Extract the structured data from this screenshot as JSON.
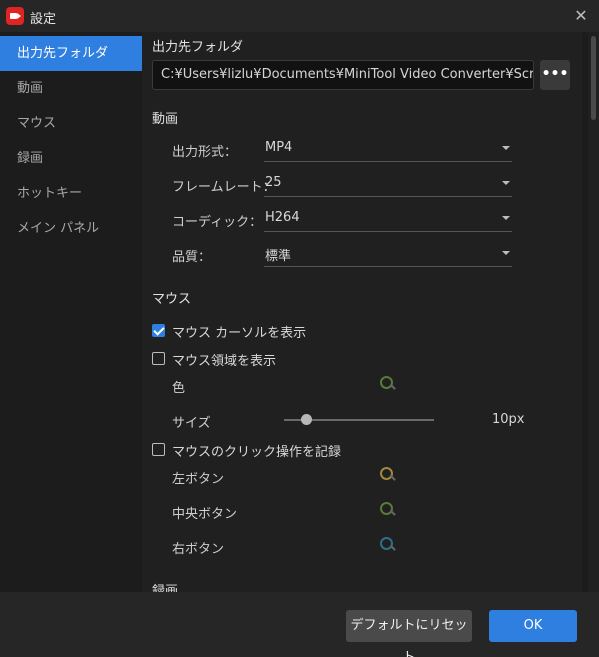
{
  "window": {
    "title": "設定",
    "close_glyph": "✕"
  },
  "sidebar": {
    "items": [
      {
        "label": "出力先フォルダ",
        "active": true
      },
      {
        "label": "動画"
      },
      {
        "label": "マウス"
      },
      {
        "label": "録画"
      },
      {
        "label": "ホットキー"
      },
      {
        "label": "メイン パネル"
      }
    ]
  },
  "output_folder": {
    "title": "出力先フォルダ",
    "path": "C:¥Users¥lizlu¥Documents¥MiniTool Video Converter¥Screen Record",
    "browse_glyph": "•••"
  },
  "video": {
    "title": "動画",
    "rows": [
      {
        "label": "出力形式：",
        "value": "MP4"
      },
      {
        "label": "フレームレート：",
        "value": "25"
      },
      {
        "label": "コーディック：",
        "value": "H264"
      },
      {
        "label": "品質：",
        "value": "標準"
      }
    ]
  },
  "mouse": {
    "title": "マウス",
    "show_cursor": {
      "label": "マウス カーソルを表示",
      "checked": true
    },
    "show_area": {
      "label": "マウス領域を表示",
      "checked": false
    },
    "color_label": "色",
    "size_label": "サイズ",
    "size_value": "10px",
    "size_fraction": 0.15,
    "record_clicks": {
      "label": "マウスのクリック操作を記録",
      "checked": false
    },
    "left_button": "左ボタン",
    "middle_button": "中央ボタン",
    "right_button": "右ボタン",
    "colors": {
      "area": "#5a7a3a",
      "left": "#a08a3a",
      "middle": "#5a7a3a",
      "right": "#2f6f8a"
    }
  },
  "recording": {
    "title": "録画"
  },
  "footer": {
    "reset_label": "デフォルトにリセット",
    "ok_label": "OK"
  },
  "colors": {
    "accent": "#2f7fe0",
    "app_icon": "#e02424"
  }
}
